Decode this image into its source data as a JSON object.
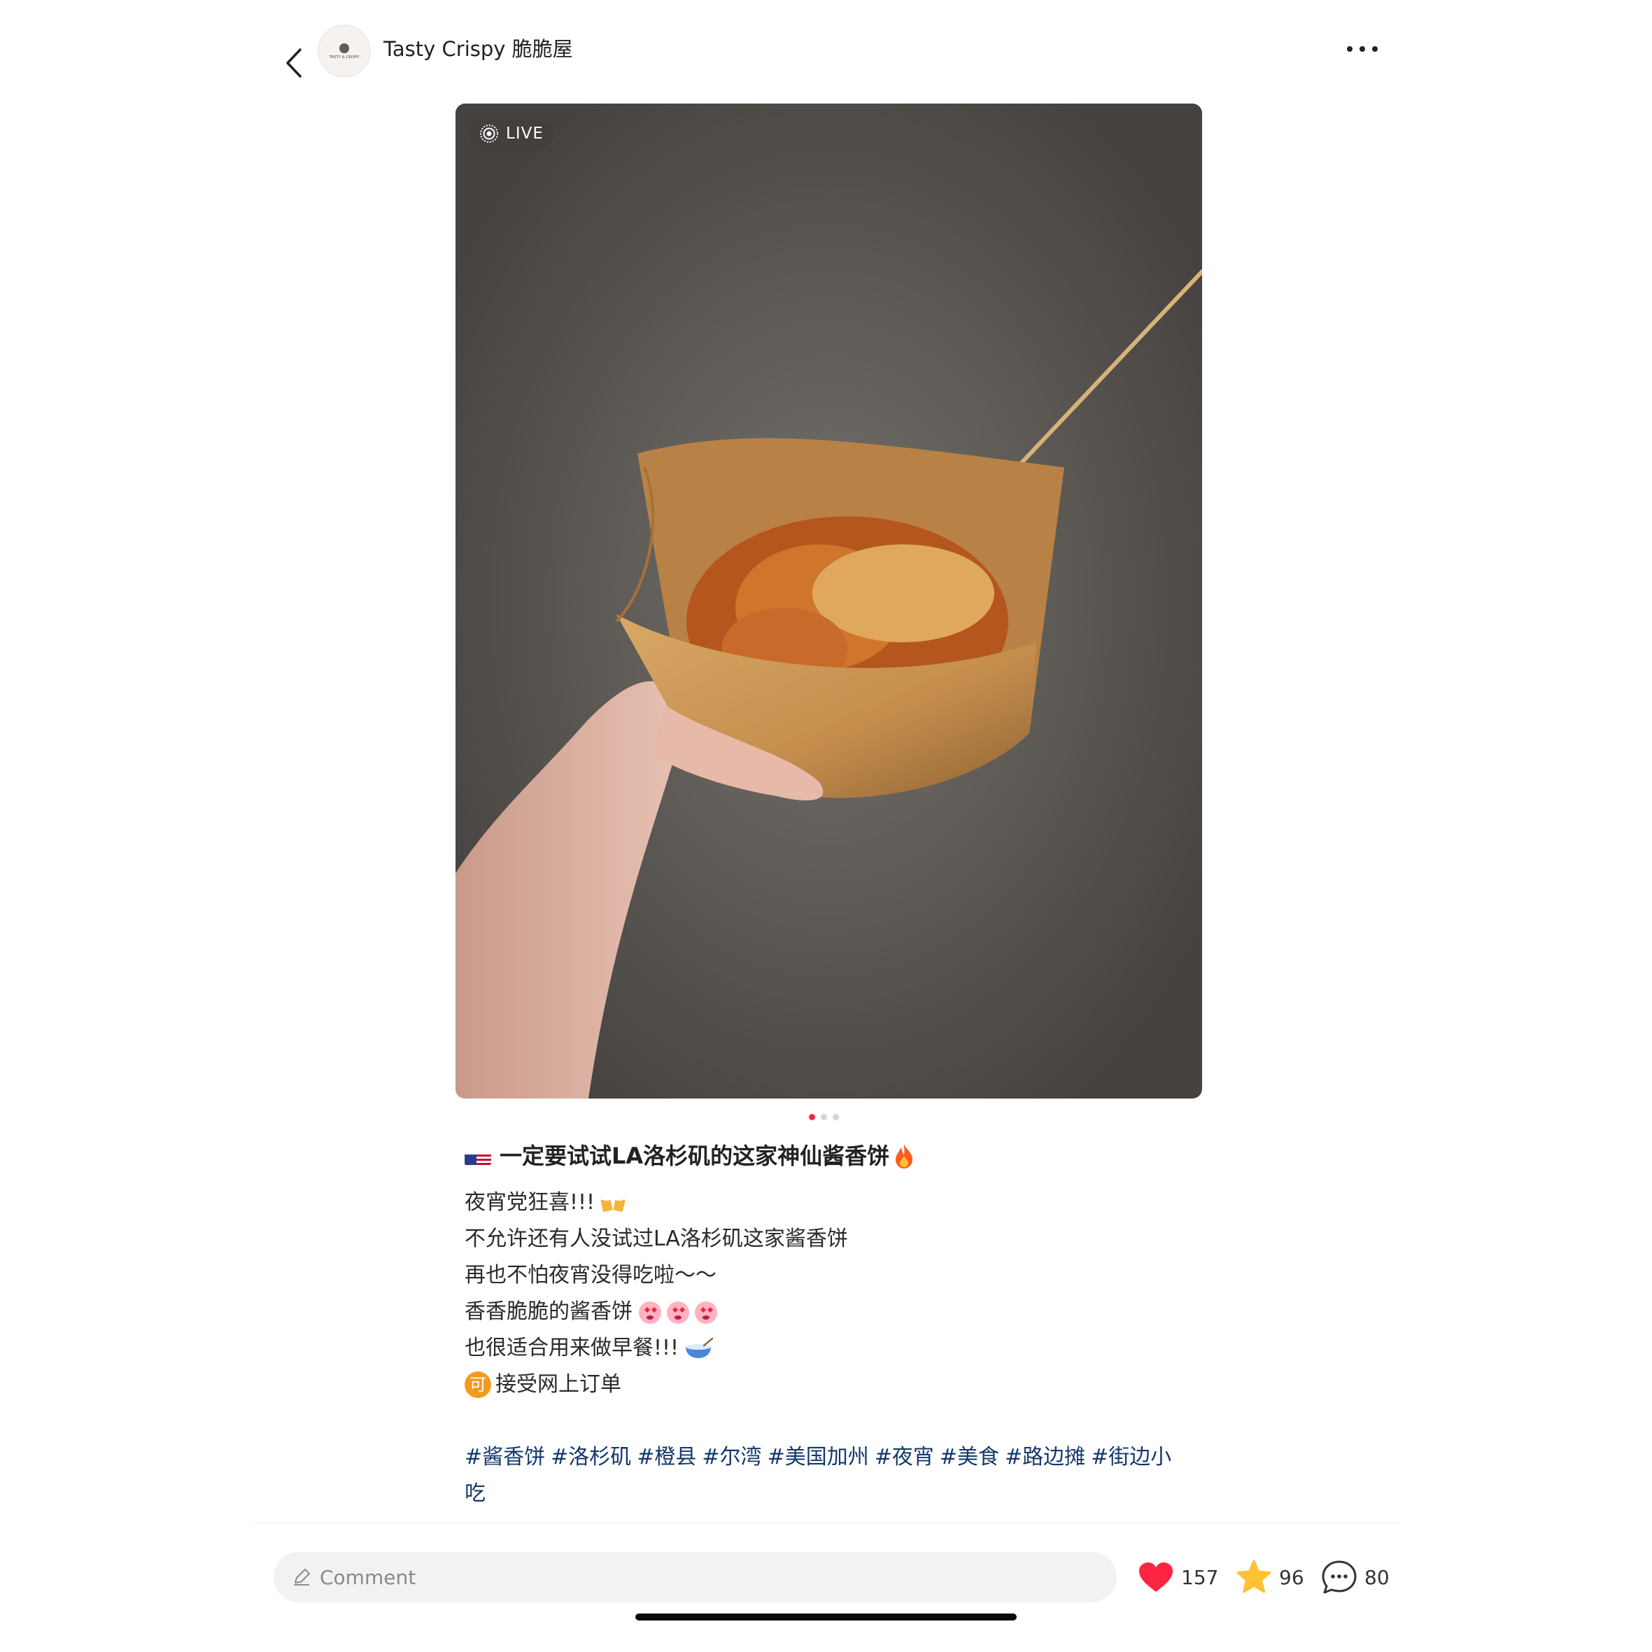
{
  "header": {
    "account_name": "Tasty Crispy 脆脆屋",
    "avatar_text": "TASTY & CRISPY",
    "back_icon": "chevron-left-icon",
    "more_icon": "more-horizontal-icon"
  },
  "media": {
    "live_label": "LIVE",
    "page_count": 3,
    "current_page": 1
  },
  "post": {
    "title": "一定要试试LA洛杉矶的这家神仙酱香饼",
    "title_prefix_icon": "us-flag-icon",
    "title_suffix_icon": "fire-icon",
    "lines": [
      {
        "text": "夜宵党狂喜!!! ",
        "icon": "beer-cheers-icon"
      },
      {
        "text": "不允许还有人没试过LA洛杉矶这家酱香饼",
        "icon": null
      },
      {
        "text": "再也不怕夜宵没得吃啦～～",
        "icon": null
      },
      {
        "text": "香香脆脆的酱香饼",
        "icon": "heart-eyes-face-icon-x3"
      },
      {
        "text": "也很适合用来做早餐!!! ",
        "icon": "bowl-icon"
      },
      {
        "text": "接受网上订单",
        "icon": "ke-badge-icon"
      }
    ],
    "ke_badge_char": "可",
    "tags": [
      "#酱香饼",
      "#洛杉矶",
      "#橙县",
      "#尔湾",
      "#美国加州",
      "#夜宵",
      "#美食",
      "#路边摊",
      "#街边小吃"
    ]
  },
  "bottom_bar": {
    "comment_placeholder": "Comment",
    "likes": "157",
    "favorites": "96",
    "comments": "80"
  },
  "colors": {
    "accent": "#ff2442",
    "tag": "#13386c",
    "star": "#ffc233"
  }
}
